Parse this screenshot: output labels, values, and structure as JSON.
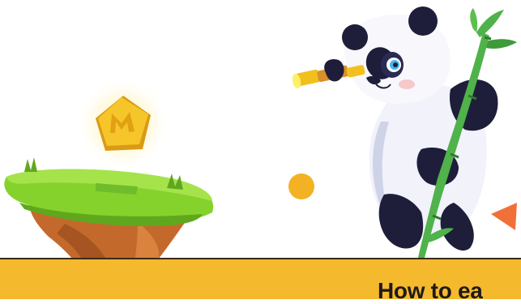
{
  "banner": {
    "title": "How to ea"
  },
  "colors": {
    "banner_bg": "#f4b92c",
    "grass": "#86d22c",
    "soil": "#c4692c",
    "coin": "#f6c52a",
    "panda_dark": "#1e1e3a",
    "bamboo": "#4fb24a",
    "dot": "#f2b224",
    "triangle": "#f0703a"
  },
  "icons": {
    "coin": "m-coin-icon",
    "island": "floating-island",
    "mascot": "panda-with-telescope",
    "dot": "yellow-dot",
    "triangle": "orange-triangle"
  }
}
